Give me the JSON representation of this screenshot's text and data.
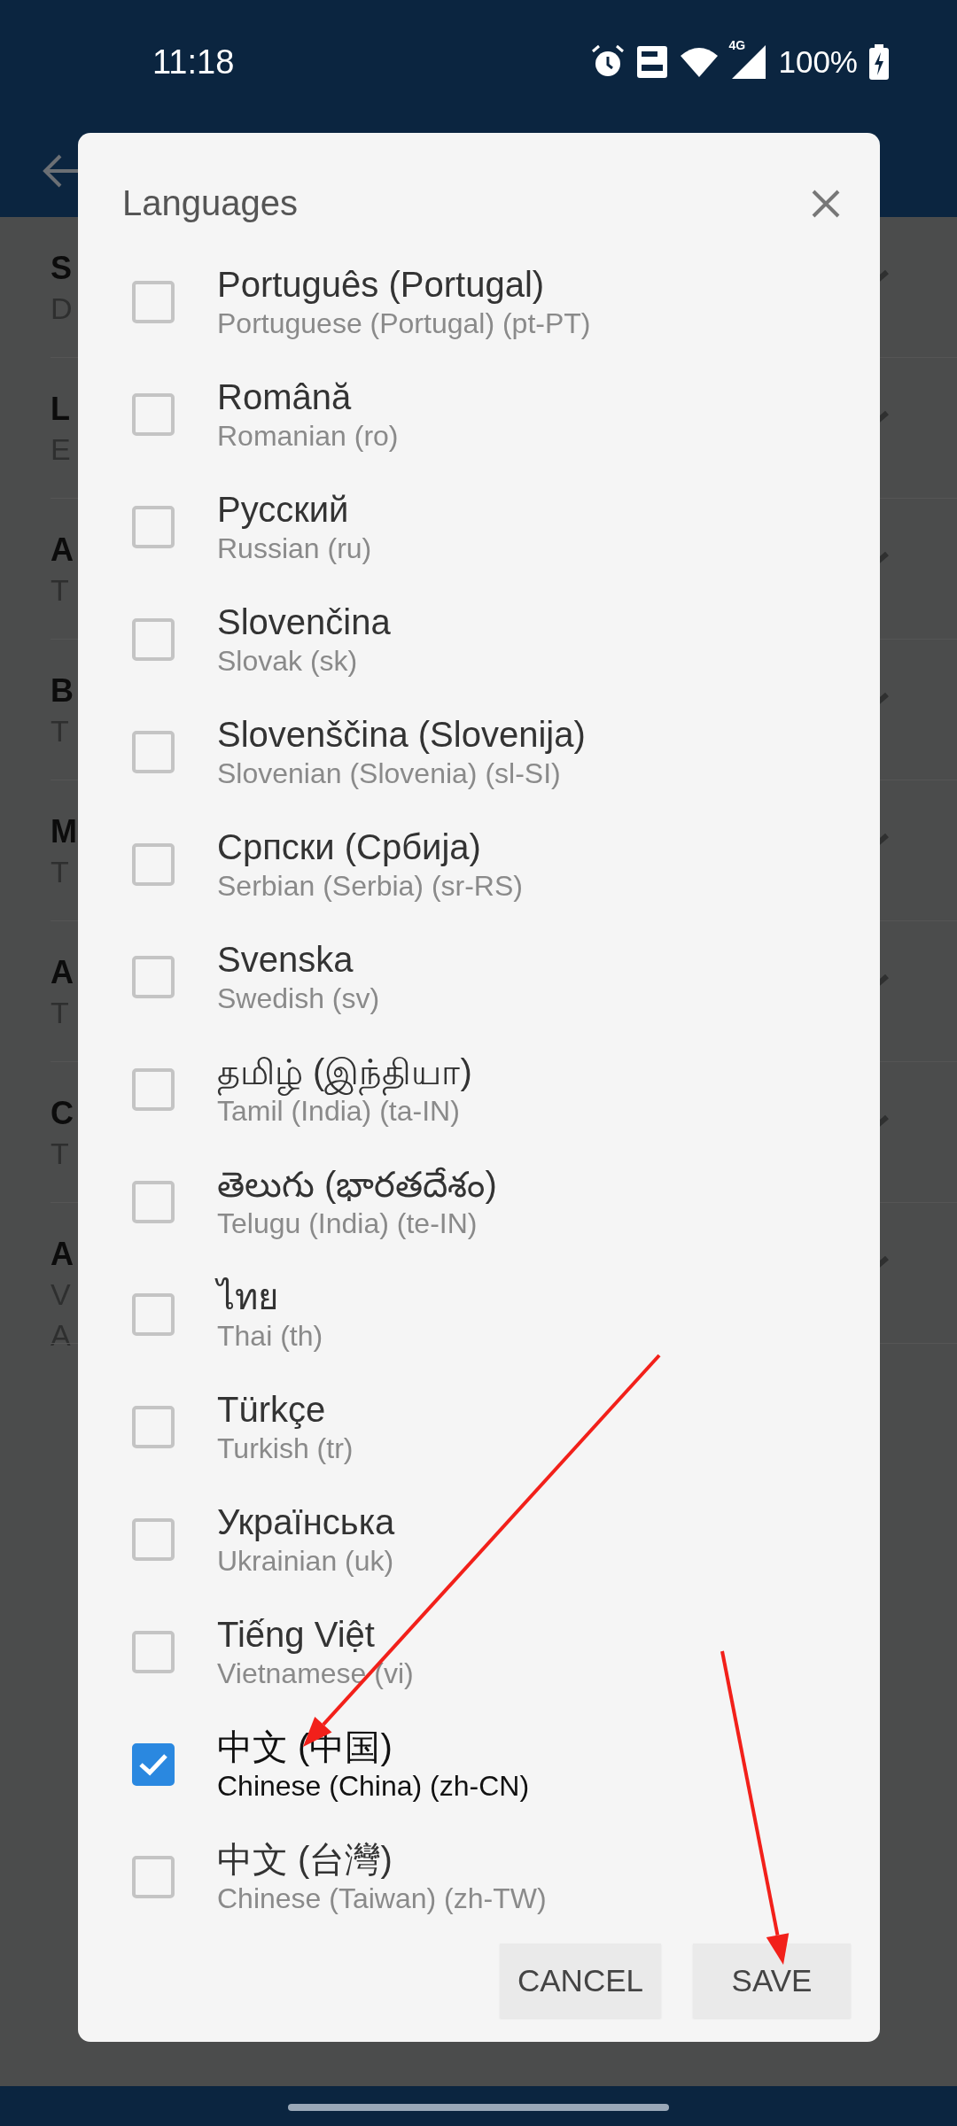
{
  "status_bar": {
    "time": "11:18",
    "network": "4G",
    "battery": "100%"
  },
  "background_list": [
    {
      "title": "S",
      "lines": [
        "D"
      ]
    },
    {
      "title": "L",
      "lines": [
        "E"
      ]
    },
    {
      "title": "A",
      "lines": [
        "T"
      ]
    },
    {
      "title": "B",
      "lines": [
        "T"
      ]
    },
    {
      "title": "M",
      "lines": [
        "T"
      ]
    },
    {
      "title": "A",
      "lines": [
        "T"
      ]
    },
    {
      "title": "C",
      "lines": [
        "T"
      ]
    },
    {
      "title": "A",
      "lines": [
        "V",
        "A"
      ]
    }
  ],
  "dialog": {
    "title": "Languages",
    "items": [
      {
        "name": "Português (Portugal)",
        "detail": "Portuguese (Portugal) (pt-PT)",
        "checked": false
      },
      {
        "name": "Română",
        "detail": "Romanian (ro)",
        "checked": false
      },
      {
        "name": "Русский",
        "detail": "Russian (ru)",
        "checked": false
      },
      {
        "name": "Slovenčina",
        "detail": "Slovak (sk)",
        "checked": false
      },
      {
        "name": "Slovenščina (Slovenija)",
        "detail": "Slovenian (Slovenia) (sl-SI)",
        "checked": false
      },
      {
        "name": "Српски (Србија)",
        "detail": "Serbian (Serbia) (sr-RS)",
        "checked": false
      },
      {
        "name": "Svenska",
        "detail": "Swedish (sv)",
        "checked": false
      },
      {
        "name": "தமிழ் (இந்தியா)",
        "detail": "Tamil (India) (ta-IN)",
        "checked": false
      },
      {
        "name": "తెలుగు (భారతదేశం)",
        "detail": "Telugu (India) (te-IN)",
        "checked": false
      },
      {
        "name": "ไทย",
        "detail": "Thai (th)",
        "checked": false
      },
      {
        "name": "Türkçe",
        "detail": "Turkish (tr)",
        "checked": false
      },
      {
        "name": "Українська",
        "detail": "Ukrainian (uk)",
        "checked": false
      },
      {
        "name": "Tiếng Việt",
        "detail": "Vietnamese (vi)",
        "checked": false
      },
      {
        "name": "中文 (中国)",
        "detail": "Chinese (China) (zh-CN)",
        "checked": true
      },
      {
        "name": "中文 (台灣)",
        "detail": "Chinese (Taiwan) (zh-TW)",
        "checked": false
      }
    ],
    "buttons": [
      "CANCEL",
      "SAVE"
    ]
  },
  "annotations": [
    {
      "kind": "arrow"
    },
    {
      "kind": "arrow"
    }
  ]
}
